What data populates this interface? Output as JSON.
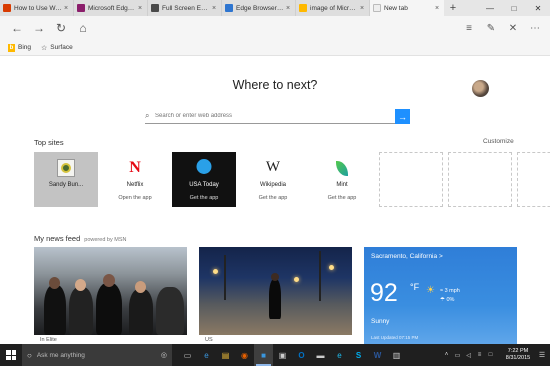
{
  "tabs": [
    {
      "label": "How to Use Work",
      "favicon_color": "#d83b01",
      "active": false
    },
    {
      "label": "Microsoft Edge re",
      "favicon_color": "#8b1e6b",
      "active": false
    },
    {
      "label": "Full Screen Edge +",
      "favicon_color": "#4a4a4a",
      "active": false
    },
    {
      "label": "Edge Browser feat",
      "favicon_color": "#2e75d0",
      "active": false
    },
    {
      "label": "image of Microsof",
      "favicon_color": "#ffb900",
      "active": false
    },
    {
      "label": "New tab",
      "favicon_color": "#eeeeee",
      "active": true
    }
  ],
  "icons": {
    "back": "←",
    "forward": "→",
    "refresh": "↻",
    "home": "⌂",
    "hub": "≡",
    "note": "✎",
    "share": "✕",
    "more": "⋯",
    "close": "×",
    "plus": "+",
    "chevron": "‹",
    "minimize": "—",
    "maximize": "□",
    "window_close": "✕",
    "search": "⌕",
    "go": "→",
    "star": "☆",
    "mic": "◎",
    "search_cortana": "○"
  },
  "favorites": [
    {
      "label": "Bing",
      "icon": "bing-icon"
    },
    {
      "label": "Surface",
      "icon": "star-icon"
    }
  ],
  "page": {
    "headline": "Where to next?",
    "search_placeholder": "Search or enter web address",
    "top_sites_title": "Top sites",
    "customize_label": "Customize",
    "news_feed_title": "My news feed",
    "powered_by": "powered by MSN"
  },
  "top_sites": [
    {
      "name": "Sandy Bun...",
      "sub": "",
      "style": "sandy"
    },
    {
      "name": "Netflix",
      "sub": "Open the app",
      "style": "netflix"
    },
    {
      "name": "USA Today",
      "sub": "Get the app",
      "style": "usa"
    },
    {
      "name": "Wikipedia",
      "sub": "Get the app",
      "style": "wiki"
    },
    {
      "name": "Mint",
      "sub": "Get the app",
      "style": "mint"
    }
  ],
  "wiki_glyph": "W",
  "netflix_glyph": "N",
  "weather": {
    "city": "Sacramento, California",
    "chevron": ">",
    "temp": "92",
    "unit": "°F",
    "wind": "3 mph",
    "rain": "0%",
    "condition": "Sunny",
    "updated": "Last Updated 07:15 PM",
    "sun_glyph": "☀",
    "wind_glyph": "≈",
    "rain_glyph": "☂"
  },
  "news_captions": [
    "In Elite",
    "US"
  ],
  "taskbar": {
    "search_text": "Ask me anything",
    "time": "7:22 PM",
    "date": "8/31/2015",
    "apps": [
      {
        "name": "task-view-icon",
        "glyph": "▭",
        "active": false
      },
      {
        "name": "edge-app-icon",
        "glyph": "e",
        "active": false
      },
      {
        "name": "file-explorer-icon",
        "glyph": "▤",
        "active": false
      },
      {
        "name": "firefox-icon",
        "glyph": "◉",
        "active": false
      },
      {
        "name": "blue-app-icon",
        "glyph": "■",
        "active": true
      },
      {
        "name": "store-icon",
        "glyph": "▣",
        "active": false
      },
      {
        "name": "outlook-icon",
        "glyph": "O",
        "active": false
      },
      {
        "name": "media-icon",
        "glyph": "▬",
        "active": false
      },
      {
        "name": "ie-icon",
        "glyph": "e",
        "active": false
      },
      {
        "name": "skype-icon",
        "glyph": "S",
        "active": false
      },
      {
        "name": "word-icon",
        "glyph": "W",
        "active": false
      },
      {
        "name": "explorer-icon",
        "glyph": "▥",
        "active": false
      }
    ],
    "tray": [
      "˄",
      "▭",
      "◁",
      "≡",
      "□"
    ],
    "notification_glyph": "☰"
  }
}
